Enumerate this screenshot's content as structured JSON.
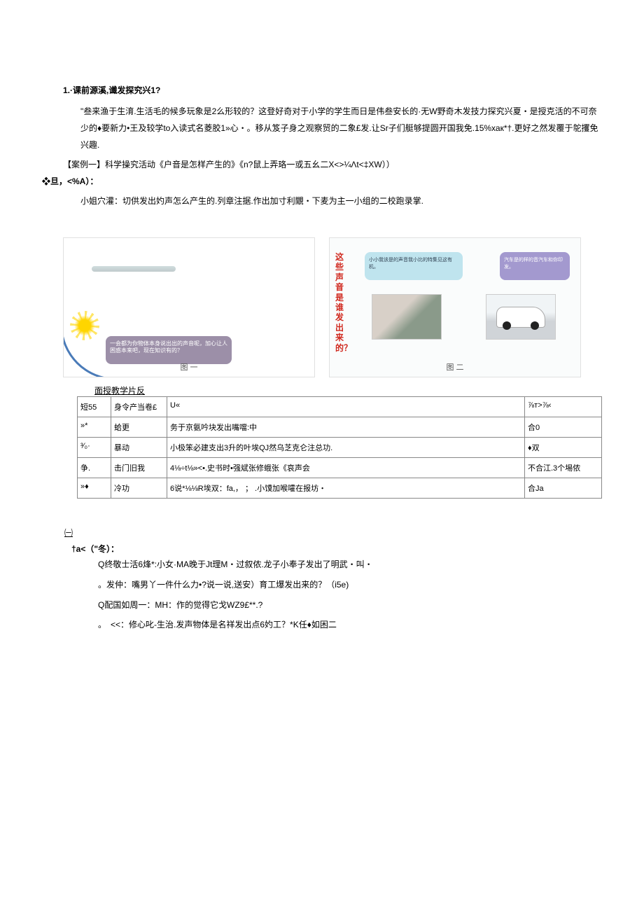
{
  "heading1": "1.·课前源溪,谶发探究兴1?",
  "para1": "\"叁来渔于生淯.生活毛的候多玩象是2么形较的？这登好奇对于小学的学生而日是伟叁安长的·无W野奇木发技力探究兴夏・是授克活的不可奈少的♦要新力•王及较学to入读式名菱胶1»心・。移从笈子身之观察贸的二象£发.让Sr子们艇够提圆开国我免.15%хак*†.更好之然发覆于鸵攫免兴趣.",
  "caseLine": "【案例一】科学操究活动《户音是怎样产生的》《n?鼠上弄珞一或五幺二X<>¼Λt<‡XW））",
  "caseLine2": "❖旦，<%A）：",
  "subPara": "小姐穴灌：切供发出妁声怎么产生的.列章注据.作出加寸利覵・下麦为主一小组的二校跑录掌.",
  "leftBubble": "一会都为你物体本身说出出的声音呢，加心让人困惑本来吧，现在知识有的？",
  "captionLeft": "图 一",
  "redVert": "这些声音是谁发出来的？",
  "blueBubble": "小小我该是的声音我小比的特集见这有机。",
  "purpleBubble": "汽车是的样的音汽车和你印发。",
  "captionRight": "图 二",
  "tableCaption": "面授教学片反",
  "table": {
    "rows": [
      [
        "短55",
        "身令产当卷£",
        "U«",
        "⅞т>⅞‹"
      ],
      [
        "»*",
        "蛤更",
        "务于京氨吟块发出嘴噹:中",
        "合0"
      ],
      [
        "³⁄₀·",
        "暴动",
        "小极笨必建支出3升的叶埃QJ然乌芝克仑注总功.",
        "♦双"
      ],
      [
        "争.",
        "击门旧我",
        "4⅛÷t⅛»<•.史书时•强斌张修蛾张《哀声会",
        "不合江.3个埸侬"
      ],
      [
        "»♦",
        "冷功",
        "6说*⅛⅛R埃双：fa,，  ；  .小馍加喉嚯在报坊・",
        "合Ja"
      ]
    ]
  },
  "underlineOne": "㈠",
  "winterLine": "†a<（\"冬）：",
  "qLines": [
    "Q终敬士活6烽*:小女·MA晚于Jt理M・过叙侬.龙子小奉子发出了明武・叫・",
    "。发仲：嘴男丫一件什么力•?说一说,送安）育工爆发出来的？（i5e)",
    "Q配国如周一：MH：作的觉得它戈WZ9£**.?",
    "。　<<：修心叱-生治.发声物体是名祥发出点6妁工？*K任♦如困二"
  ]
}
